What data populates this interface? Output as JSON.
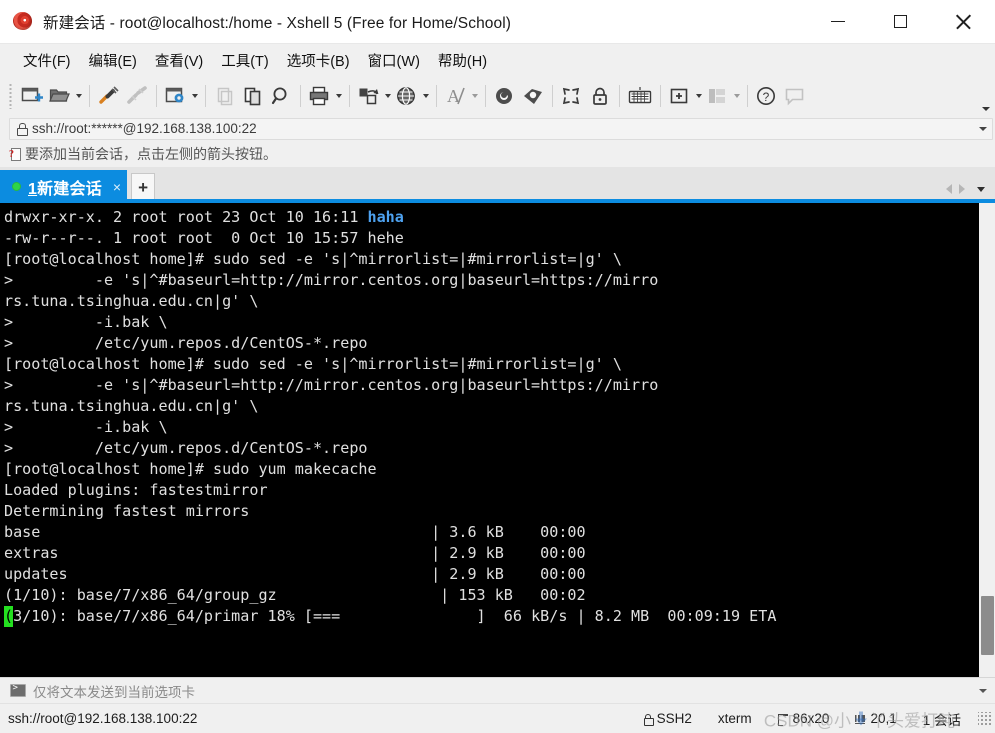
{
  "window": {
    "title": "新建会话 - root@localhost:/home - Xshell 5 (Free for Home/School)",
    "logo_icon": "xshell-shell-logo-icon",
    "minimize_icon": "minimize-icon",
    "maximize_icon": "maximize-icon",
    "close_icon": "close-icon"
  },
  "menu": {
    "items": [
      {
        "label": "文件(F)",
        "name": "menu-file"
      },
      {
        "label": "编辑(E)",
        "name": "menu-edit"
      },
      {
        "label": "查看(V)",
        "name": "menu-view"
      },
      {
        "label": "工具(T)",
        "name": "menu-tools"
      },
      {
        "label": "选项卡(B)",
        "name": "menu-tab"
      },
      {
        "label": "窗口(W)",
        "name": "menu-window"
      },
      {
        "label": "帮助(H)",
        "name": "menu-help"
      }
    ]
  },
  "toolbar": {
    "overflow_label": "toolbar-overflow-chevron"
  },
  "address": {
    "value": "ssh://root:******@192.168.138.100:22",
    "lock_icon": "lock-icon",
    "dropdown_icon": "chevron-down-icon"
  },
  "notice": {
    "text": "要添加当前会话，点击左侧的箭头按钮。",
    "icon": "session-note-icon"
  },
  "tabs": {
    "active": {
      "number": "1",
      "label": "新建会话",
      "close_label": "×",
      "status": "connected"
    },
    "new_tab_label": "+",
    "nav_prev_icon": "nav-prev-icon",
    "nav_next_icon": "nav-next-icon",
    "nav_list_icon": "tab-list-chevron-icon"
  },
  "terminal": {
    "lines": [
      {
        "segments": [
          {
            "text": "drwxr-xr-x. 2 root root 23 Oct 10 16:11 "
          },
          {
            "text": "haha",
            "style": "dir"
          }
        ]
      },
      {
        "segments": [
          {
            "text": "-rw-r--r--. 1 root root  0 Oct 10 15:57 hehe"
          }
        ]
      },
      {
        "segments": [
          {
            "text": "[root@localhost home]# sudo sed -e 's|^mirrorlist=|#mirrorlist=|g' \\"
          }
        ]
      },
      {
        "segments": [
          {
            "text": ">         -e 's|^#baseurl=http://mirror.centos.org|baseurl=https://mirro"
          }
        ]
      },
      {
        "segments": [
          {
            "text": "rs.tuna.tsinghua.edu.cn|g' \\"
          }
        ]
      },
      {
        "segments": [
          {
            "text": ">         -i.bak \\"
          }
        ]
      },
      {
        "segments": [
          {
            "text": ">         /etc/yum.repos.d/CentOS-*.repo"
          }
        ]
      },
      {
        "segments": [
          {
            "text": "[root@localhost home]# sudo sed -e 's|^mirrorlist=|#mirrorlist=|g' \\"
          }
        ]
      },
      {
        "segments": [
          {
            "text": ">         -e 's|^#baseurl=http://mirror.centos.org|baseurl=https://mirro"
          }
        ]
      },
      {
        "segments": [
          {
            "text": "rs.tuna.tsinghua.edu.cn|g' \\"
          }
        ]
      },
      {
        "segments": [
          {
            "text": ">         -i.bak \\"
          }
        ]
      },
      {
        "segments": [
          {
            "text": ">         /etc/yum.repos.d/CentOS-*.repo"
          }
        ]
      },
      {
        "segments": [
          {
            "text": "[root@localhost home]# sudo yum makecache"
          }
        ]
      },
      {
        "segments": [
          {
            "text": "Loaded plugins: fastestmirror"
          }
        ]
      },
      {
        "segments": [
          {
            "text": "Determining fastest mirrors"
          }
        ]
      },
      {
        "segments": [
          {
            "text": "base                                           | 3.6 kB    00:00"
          }
        ]
      },
      {
        "segments": [
          {
            "text": "extras                                         | 2.9 kB    00:00"
          }
        ]
      },
      {
        "segments": [
          {
            "text": "updates                                        | 2.9 kB    00:00"
          }
        ]
      },
      {
        "segments": [
          {
            "text": "(1/10): base/7/x86_64/group_gz                  | 153 kB   00:02"
          }
        ]
      },
      {
        "segments": [
          {
            "text": "(",
            "style": "cursor"
          },
          {
            "text": "3/10): base/7/x86_64/primar 18% [===               ]  66 kB/s | 8.2 MB  00:09:19 ETA"
          }
        ]
      }
    ]
  },
  "send_bar": {
    "text": "仅将文本发送到当前选项卡",
    "icon": "terminal-prompt-icon",
    "dropdown_icon": "chevron-down-icon"
  },
  "status": {
    "url": "ssh://root@192.168.138.100:22",
    "protocol": "SSH2",
    "terminal_type": "xterm",
    "size": "86x20",
    "cursor_position": "20,1",
    "sessions": "1 会话",
    "watermark_prefix": "CSDN @小",
    "watermark_suffix": "丫头爱打吨"
  },
  "colors": {
    "accent": "#0c8ce0",
    "terminal_bg": "#000000",
    "terminal_fg": "#e0e0e0",
    "dir_color": "#4ea2f0",
    "cursor_color": "#24e020",
    "chrome_bg": "#f0f0f0"
  }
}
